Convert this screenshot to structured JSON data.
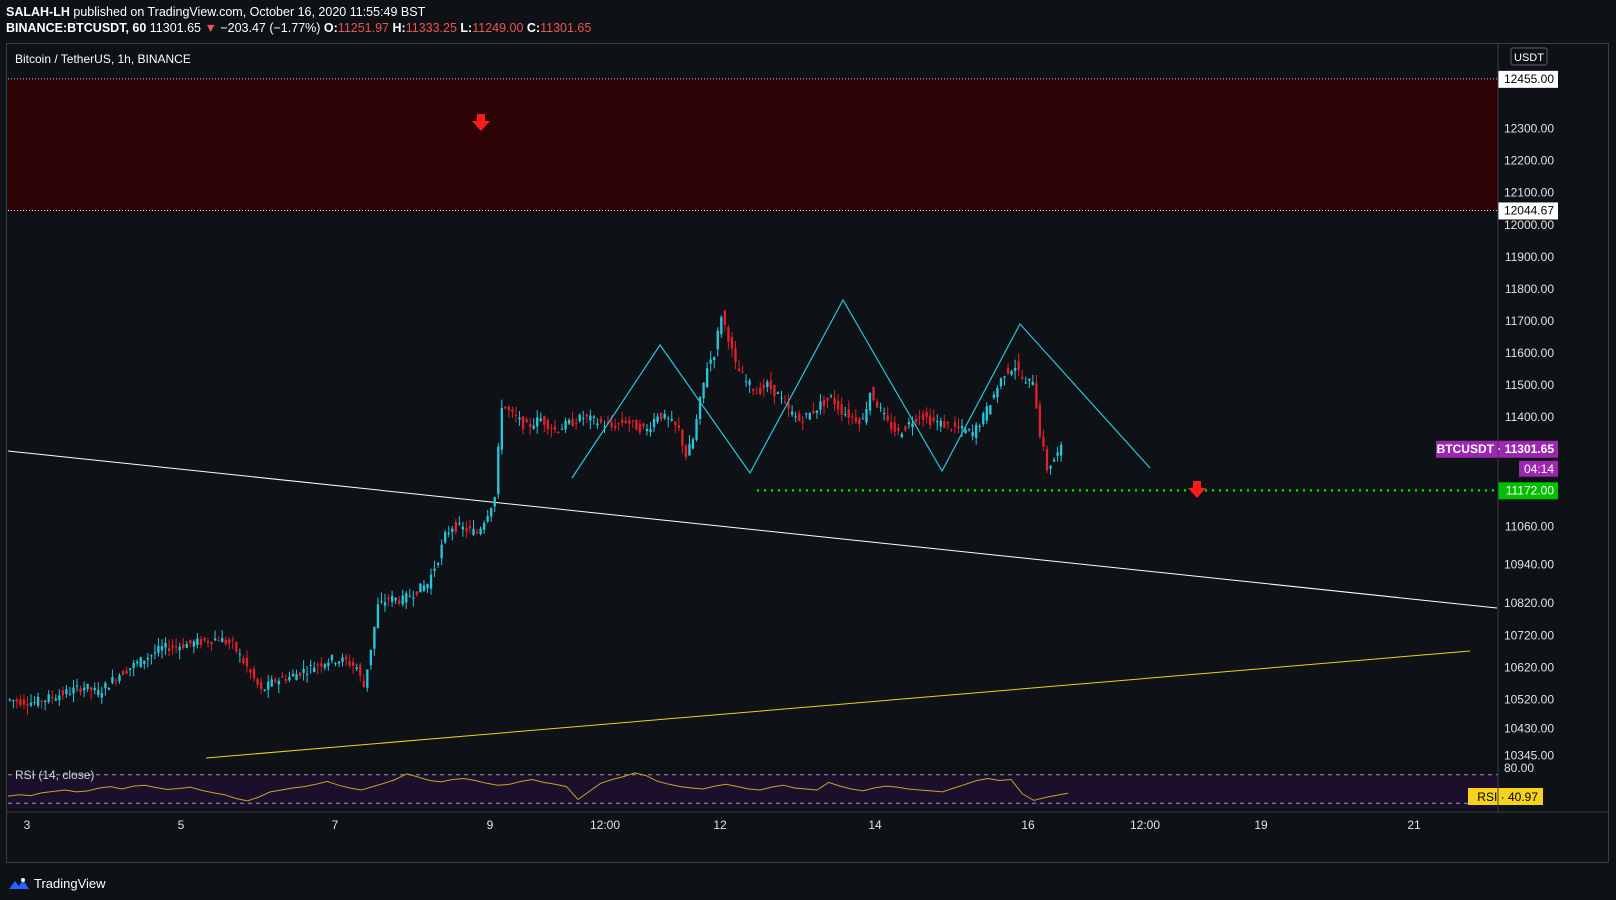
{
  "header": {
    "author": "SALAH-LH",
    "published": "published on TradingView.com, October 16, 2020 11:55:49 BST",
    "symbol_line": "BINANCE:BTCUSDT, 60",
    "last": "11301.65",
    "change": "−203.47 (−1.77%)",
    "o_label": "O:",
    "o": "11251.97",
    "h_label": "H:",
    "h": "11333.25",
    "l_label": "L:",
    "l": "11249.00",
    "c_label": "C:",
    "c": "11301.65"
  },
  "chart_title": "Bitcoin / TetherUS, 1h, BINANCE",
  "currency": "USDT",
  "footer_brand": "TradingView",
  "colors": {
    "background": "#0e1116",
    "resistance_zone": "#2e0306",
    "up_candle": "#26c6da",
    "down_candle": "#e0202a",
    "pattern_line": "#26c6da",
    "support_line": "#00e000",
    "rsi_line": "#c9a227",
    "trend_white": "#ffffff",
    "trend_yellow": "#e5d51a",
    "symbol_tag": "#9c27b0",
    "rsi_tag": "#f5d21b"
  },
  "chart_data": {
    "type": "candlestick",
    "title": "Bitcoin / TetherUS, 1h, BINANCE",
    "ylim": [
      10300,
      12520
    ],
    "x_tick_labels": [
      "3",
      "5",
      "7",
      "9",
      "12:00",
      "12",
      "14",
      "16",
      "12:00",
      "19",
      "21"
    ],
    "y_tick_labels": [
      12300,
      12200,
      12100,
      12000,
      11900,
      11800,
      11700,
      11600,
      11500,
      11400,
      11060,
      10940,
      10820,
      10720,
      10620,
      10520,
      10430,
      10345
    ],
    "price_tags": [
      {
        "label": "12455.00",
        "value": 12455
      },
      {
        "label": "12044.67",
        "value": 12044.67
      },
      {
        "label": "11172.00",
        "value": 11172
      }
    ],
    "symbol_tag": {
      "label": "BTCUSDT",
      "price": "11301.65",
      "countdown": "04:14",
      "value": 11301.65
    },
    "resistance_zone": [
      12044.67,
      12455
    ],
    "support_level": 11172,
    "price_path": [
      [
        0,
        10520
      ],
      [
        8,
        10510
      ],
      [
        15,
        10535
      ],
      [
        22,
        10560
      ],
      [
        26,
        10540
      ],
      [
        32,
        10600
      ],
      [
        38,
        10640
      ],
      [
        44,
        10680
      ],
      [
        50,
        10690
      ],
      [
        55,
        10700
      ],
      [
        60,
        10710
      ],
      [
        64,
        10690
      ],
      [
        68,
        10620
      ],
      [
        72,
        10545
      ],
      [
        76,
        10580
      ],
      [
        80,
        10590
      ],
      [
        84,
        10610
      ],
      [
        88,
        10630
      ],
      [
        92,
        10645
      ],
      [
        96,
        10640
      ],
      [
        99,
        10620
      ],
      [
        101,
        10560
      ],
      [
        103,
        10680
      ],
      [
        105,
        10810
      ],
      [
        108,
        10835
      ],
      [
        112,
        10830
      ],
      [
        116,
        10860
      ],
      [
        119,
        10880
      ],
      [
        122,
        10960
      ],
      [
        124,
        11030
      ],
      [
        126,
        11060
      ],
      [
        130,
        11050
      ],
      [
        133,
        11040
      ],
      [
        135,
        11080
      ],
      [
        138,
        11150
      ],
      [
        140,
        11440
      ],
      [
        143,
        11405
      ],
      [
        147,
        11370
      ],
      [
        151,
        11395
      ],
      [
        155,
        11360
      ],
      [
        159,
        11380
      ],
      [
        163,
        11400
      ],
      [
        167,
        11385
      ],
      [
        171,
        11370
      ],
      [
        175,
        11390
      ],
      [
        178,
        11370
      ],
      [
        181,
        11360
      ],
      [
        184,
        11410
      ],
      [
        187,
        11390
      ],
      [
        190,
        11360
      ],
      [
        192,
        11280
      ],
      [
        194,
        11330
      ],
      [
        196,
        11450
      ],
      [
        198,
        11560
      ],
      [
        200,
        11600
      ],
      [
        202,
        11720
      ],
      [
        204,
        11650
      ],
      [
        206,
        11560
      ],
      [
        209,
        11510
      ],
      [
        212,
        11480
      ],
      [
        215,
        11500
      ],
      [
        218,
        11470
      ],
      [
        221,
        11420
      ],
      [
        224,
        11390
      ],
      [
        227,
        11410
      ],
      [
        230,
        11440
      ],
      [
        233,
        11460
      ],
      [
        236,
        11420
      ],
      [
        239,
        11400
      ],
      [
        242,
        11390
      ],
      [
        244,
        11480
      ],
      [
        246,
        11440
      ],
      [
        249,
        11380
      ],
      [
        252,
        11350
      ],
      [
        255,
        11380
      ],
      [
        258,
        11410
      ],
      [
        261,
        11390
      ],
      [
        264,
        11380
      ],
      [
        267,
        11370
      ],
      [
        270,
        11360
      ],
      [
        273,
        11350
      ],
      [
        276,
        11400
      ],
      [
        279,
        11470
      ],
      [
        282,
        11540
      ],
      [
        285,
        11560
      ],
      [
        288,
        11500
      ],
      [
        290,
        11520
      ],
      [
        292,
        11350
      ],
      [
        294,
        11240
      ],
      [
        296,
        11270
      ],
      [
        298,
        11300
      ]
    ],
    "rsi": {
      "label": "RSI (14, close)",
      "levels": [
        80,
        20
      ],
      "level_labels": [
        "80.00"
      ],
      "tag_label": "RSI",
      "last_value": "40.97",
      "values": [
        35,
        38,
        36,
        42,
        45,
        48,
        44,
        46,
        52,
        55,
        50,
        56,
        58,
        53,
        49,
        51,
        54,
        47,
        42,
        38,
        30,
        25,
        33,
        44,
        48,
        52,
        55,
        60,
        66,
        58,
        52,
        48,
        55,
        62,
        70,
        82,
        75,
        68,
        65,
        70,
        72,
        68,
        62,
        58,
        60,
        66,
        70,
        64,
        60,
        55,
        28,
        45,
        62,
        70,
        76,
        84,
        78,
        66,
        60,
        55,
        52,
        50,
        56,
        60,
        55,
        50,
        48,
        54,
        58,
        52,
        50,
        48,
        64,
        56,
        50,
        46,
        52,
        56,
        54,
        50,
        48,
        46,
        44,
        52,
        60,
        68,
        72,
        68,
        70,
        40,
        26,
        32,
        37,
        41
      ]
    }
  }
}
